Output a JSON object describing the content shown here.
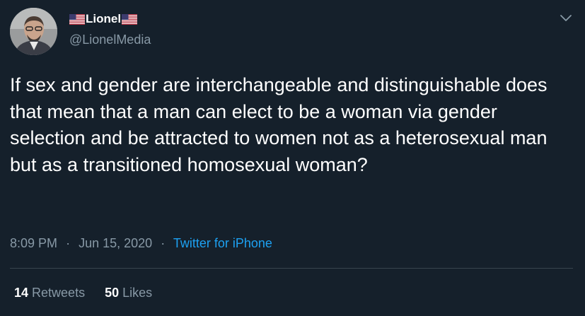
{
  "tweet": {
    "author": {
      "display_name": "Lionel",
      "handle": "@LionelMedia",
      "name_decoration_icon": "us-flag-icon",
      "avatar_icon": "avatar-photo"
    },
    "text": "If sex and gender are interchangeable and distinguishable does that mean that a man can elect to be a woman via gender selection and be attracted to women not as a heterosexual man but as a transitioned homosexual woman?",
    "time": "8:09 PM",
    "separator": "·",
    "date": "Jun 15, 2020",
    "source": "Twitter for iPhone",
    "stats": {
      "retweets_count": "14",
      "retweets_label": "Retweets",
      "likes_count": "50",
      "likes_label": "Likes"
    },
    "menu_icon": "chevron-down-icon"
  },
  "colors": {
    "background": "#15202b",
    "primary_text": "#ffffff",
    "secondary_text": "#8899a6",
    "link": "#1da1f2",
    "divider": "#38444d"
  }
}
